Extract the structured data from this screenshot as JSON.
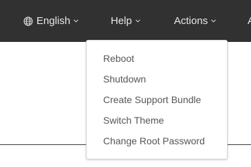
{
  "topbar": {
    "language": {
      "label": "English",
      "icon": "globe-icon"
    },
    "help": {
      "label": "Help"
    },
    "actions": {
      "label": "Actions"
    },
    "cut_item_label": "A"
  },
  "actions_menu": {
    "items": [
      {
        "label": "Reboot"
      },
      {
        "label": "Shutdown"
      },
      {
        "label": "Create Support Bundle"
      },
      {
        "label": "Switch Theme"
      },
      {
        "label": "Change Root Password"
      }
    ]
  },
  "colors": {
    "topbar_bg": "#313131",
    "topbar_text": "#e8e8e8",
    "menu_text": "#565656"
  }
}
